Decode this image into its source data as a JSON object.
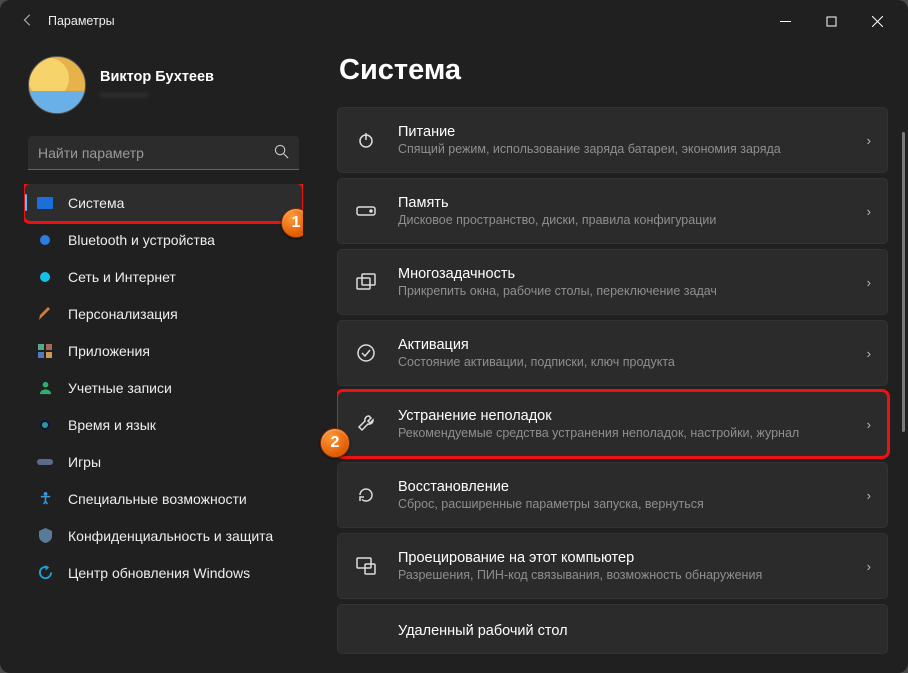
{
  "titlebar": {
    "title": "Параметры"
  },
  "profile": {
    "name": "Виктор Бухтеев",
    "sub": "————"
  },
  "search": {
    "placeholder": "Найти параметр"
  },
  "sidebar": {
    "items": [
      {
        "label": "Система"
      },
      {
        "label": "Bluetooth и устройства"
      },
      {
        "label": "Сеть и Интернет"
      },
      {
        "label": "Персонализация"
      },
      {
        "label": "Приложения"
      },
      {
        "label": "Учетные записи"
      },
      {
        "label": "Время и язык"
      },
      {
        "label": "Игры"
      },
      {
        "label": "Специальные возможности"
      },
      {
        "label": "Конфиденциальность и защита"
      },
      {
        "label": "Центр обновления Windows"
      }
    ]
  },
  "main": {
    "heading": "Система",
    "cards": [
      {
        "title": "Питание",
        "sub": "Спящий режим, использование заряда батареи, экономия заряда"
      },
      {
        "title": "Память",
        "sub": "Дисковое пространство, диски, правила конфигурации"
      },
      {
        "title": "Многозадачность",
        "sub": "Прикрепить окна, рабочие столы, переключение задач"
      },
      {
        "title": "Активация",
        "sub": "Состояние активации, подписки, ключ продукта"
      },
      {
        "title": "Устранение неполадок",
        "sub": "Рекомендуемые средства устранения неполадок, настройки, журнал"
      },
      {
        "title": "Восстановление",
        "sub": "Сброс, расширенные параметры запуска, вернуться"
      },
      {
        "title": "Проецирование на этот компьютер",
        "sub": "Разрешения, ПИН-код связывания, возможность обнаружения"
      },
      {
        "title": "Удаленный рабочий стол",
        "sub": ""
      }
    ]
  },
  "annotations": {
    "b1": "1",
    "b2": "2"
  }
}
